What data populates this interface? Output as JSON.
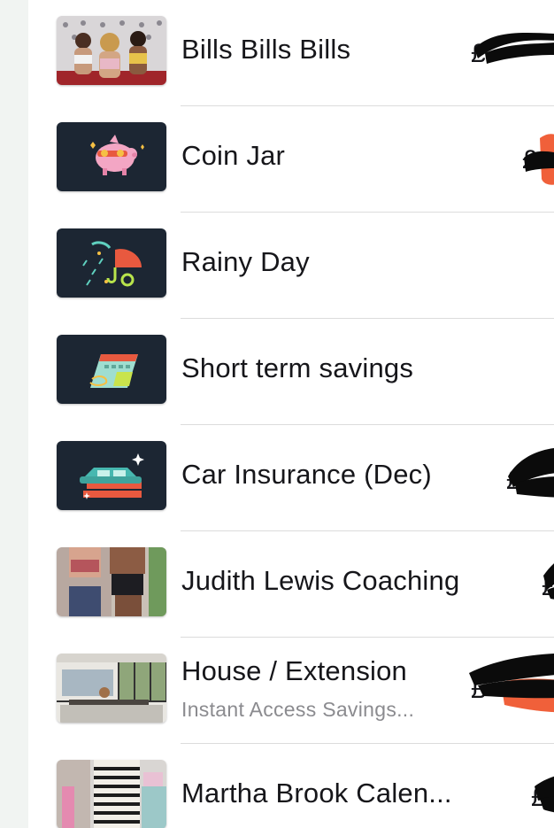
{
  "pots": [
    {
      "name": "Bills Bills Bills",
      "subtitle": "",
      "currency": "£",
      "thumbnail": "group-photo"
    },
    {
      "name": "Coin Jar",
      "subtitle": "",
      "currency": "£",
      "thumbnail": "piggy-bank-icon"
    },
    {
      "name": "Rainy Day",
      "subtitle": "",
      "currency": "£",
      "thumbnail": "umbrella-icon"
    },
    {
      "name": "Short term savings",
      "subtitle": "",
      "currency": "£",
      "thumbnail": "calendar-icon"
    },
    {
      "name": "Car Insurance (Dec)",
      "subtitle": "",
      "currency": "£",
      "thumbnail": "car-icon"
    },
    {
      "name": "Judith Lewis Coaching",
      "subtitle": "",
      "currency": "£",
      "thumbnail": "fitness-photo"
    },
    {
      "name": "House / Extension",
      "subtitle": "Instant Access Savings...",
      "currency": "£",
      "thumbnail": "room-photo"
    },
    {
      "name": "Martha Brook Calen...",
      "subtitle": "",
      "currency": "£",
      "thumbnail": "gift-photo"
    }
  ],
  "colors": {
    "icon_background": "#1c2633",
    "redaction_black": "#0b0b0b",
    "redaction_orange": "#f0603a"
  }
}
